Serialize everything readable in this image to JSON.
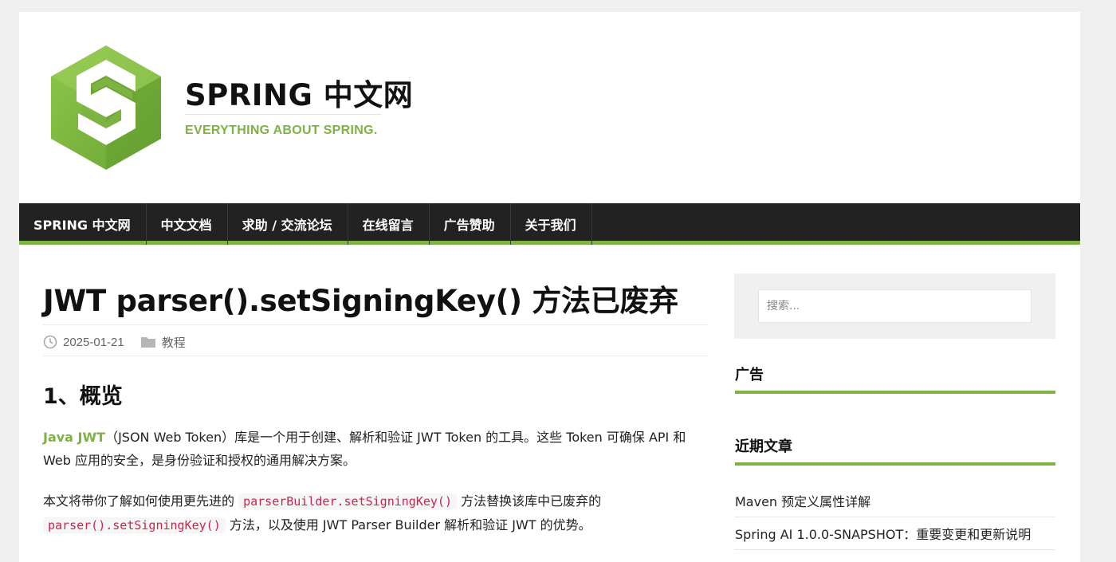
{
  "site": {
    "title": "SPRING 中文网",
    "tagline": "EVERYTHING ABOUT SPRING.",
    "brand_color": "#7cb342",
    "logo_icon": "spring-hexagon-logo"
  },
  "nav": {
    "items": [
      {
        "label": "SPRING 中文网"
      },
      {
        "label": "中文文档"
      },
      {
        "label": "求助 / 交流论坛"
      },
      {
        "label": "在线留言"
      },
      {
        "label": "广告赞助"
      },
      {
        "label": "关于我们"
      }
    ]
  },
  "post": {
    "title": "JWT parser().setSigningKey() 方法已废弃",
    "date": "2025-01-21",
    "category": "教程",
    "date_icon": "clock-icon",
    "category_icon": "folder-icon",
    "section_heading": "1、概览",
    "para1": {
      "link": "Java JWT",
      "text": "（JSON Web Token）库是一个用于创建、解析和验证 JWT Token 的工具。这些 Token 可确保 API 和 Web 应用的安全，是身份验证和授权的通用解决方案。"
    },
    "para2": {
      "part1": "本文将带你了解如何使用更先进的 ",
      "code1": "parserBuilder.setSigningKey()",
      "part2": " 方法替换该库中已废弃的 ",
      "code2": "parser().setSigningKey()",
      "part3": " 方法，以及使用 JWT Parser Builder 解析和验证 JWT 的优势。"
    }
  },
  "sidebar": {
    "search_placeholder": "搜索...",
    "ads_title": "广告",
    "recent_title": "近期文章",
    "recent_posts": [
      {
        "label": "Maven 预定义属性详解"
      },
      {
        "label": "Spring AI 1.0.0-SNAPSHOT：重要变更和更新说明"
      }
    ]
  }
}
